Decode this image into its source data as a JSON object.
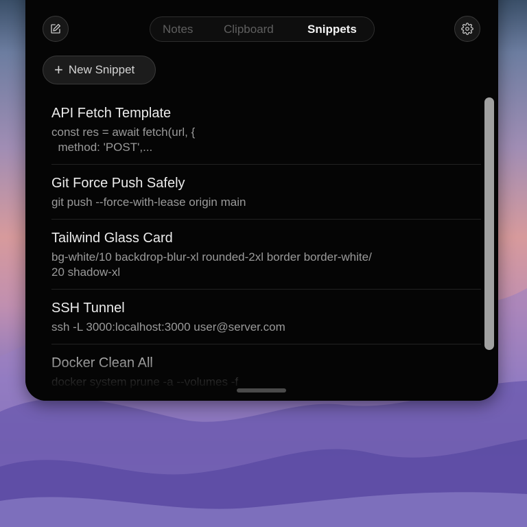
{
  "tabs": [
    {
      "label": "Notes",
      "active": false
    },
    {
      "label": "Clipboard",
      "active": false
    },
    {
      "label": "Snippets",
      "active": true
    }
  ],
  "toolbar": {
    "compose_icon": "compose-icon",
    "settings_icon": "gear-icon",
    "new_snippet_label": "New Snippet"
  },
  "snippets": [
    {
      "title": "API Fetch Template",
      "body": "const res = await fetch(url, {\n  method: 'POST',..."
    },
    {
      "title": "Git Force Push Safely",
      "body": "git push --force-with-lease origin main"
    },
    {
      "title": "Tailwind Glass Card",
      "body": "bg-white/10 backdrop-blur-xl rounded-2xl border border-white/\n20 shadow-xl"
    },
    {
      "title": "SSH Tunnel",
      "body": "ssh -L 3000:localhost:3000 user@server.com"
    },
    {
      "title": "Docker Clean All",
      "body": "docker system prune -a --volumes -f"
    }
  ]
}
